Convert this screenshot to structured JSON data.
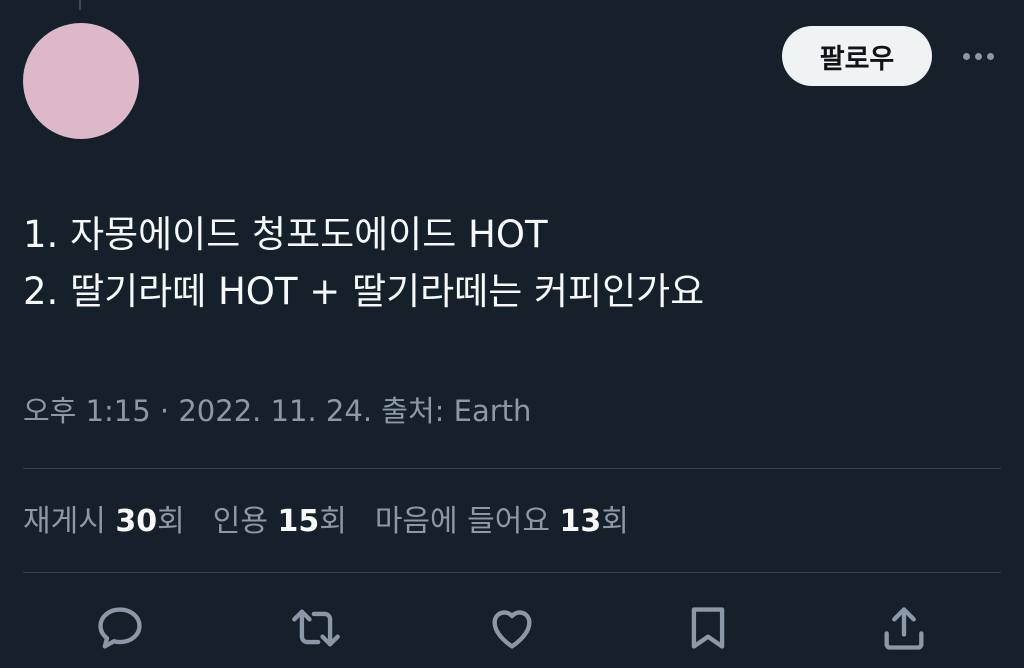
{
  "header": {
    "follow_label": "팔로우",
    "more_icon": "more-horizontal-icon"
  },
  "tweet": {
    "lines": [
      "1. 자몽에이드 청포도에이드 HOT",
      "2. 딸기라떼 HOT + 딸기라떼는 커피인가요"
    ],
    "meta": "오후 1:15 · 2022. 11. 24. 출처: Earth"
  },
  "stats": {
    "retweets": {
      "label": "재게시",
      "count": "30",
      "unit": "회"
    },
    "quotes": {
      "label": "인용",
      "count": "15",
      "unit": "회"
    },
    "likes": {
      "label": "마음에 들어요",
      "count": "13",
      "unit": "회"
    }
  },
  "actions": [
    "reply-icon",
    "retweet-icon",
    "like-icon",
    "bookmark-icon",
    "share-icon"
  ],
  "colors": {
    "background": "#15202b",
    "avatar": "#ddb8c8",
    "muted_text": "#8b98a5",
    "primary_text": "#f7f9f9"
  }
}
